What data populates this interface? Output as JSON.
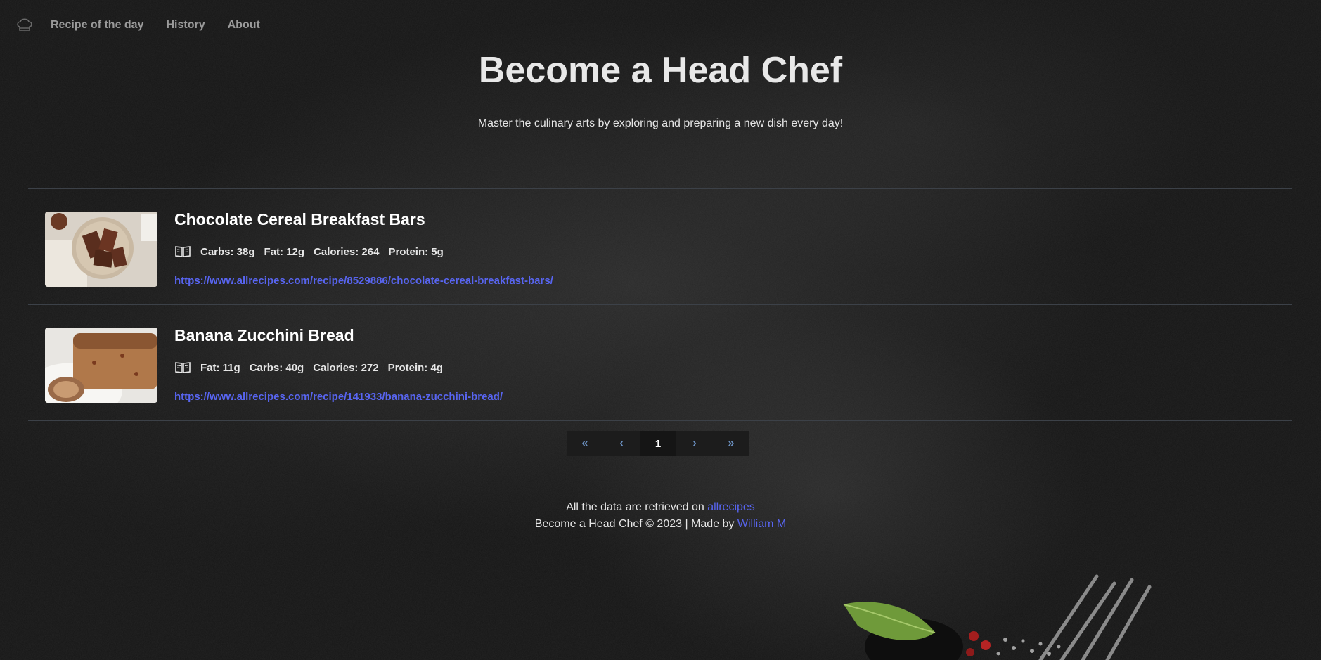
{
  "nav": {
    "logo_icon": "chef-hat-icon",
    "links": [
      "Recipe of the day",
      "History",
      "About"
    ]
  },
  "hero": {
    "title": "Become a Head Chef",
    "subtitle": "Master the culinary arts by exploring and preparing a new dish every day!"
  },
  "recipes": [
    {
      "title": "Chocolate Cereal Breakfast Bars",
      "icon": "recipe-book-icon",
      "nutrition": [
        "Carbs: 38g",
        "Fat: 12g",
        "Calories: 264",
        "Protein: 5g"
      ],
      "url": "https://www.allrecipes.com/recipe/8529886/chocolate-cereal-breakfast-bars/"
    },
    {
      "title": "Banana Zucchini Bread",
      "icon": "recipe-book-icon",
      "nutrition": [
        "Fat: 11g",
        "Carbs: 40g",
        "Calories: 272",
        "Protein: 4g"
      ],
      "url": "https://www.allrecipes.com/recipe/141933/banana-zucchini-bread/"
    }
  ],
  "pagination": {
    "first": "«",
    "prev": "‹",
    "current": "1",
    "next": "›",
    "last": "»"
  },
  "footer": {
    "line1_prefix": "All the data are retrieved on",
    "line1_link": "allrecipes",
    "line2_prefix": "Become a Head Chef © 2023 | Made by",
    "line2_link": "William M"
  },
  "colors": {
    "link": "#5865f0",
    "background": "#1a1a1a"
  }
}
